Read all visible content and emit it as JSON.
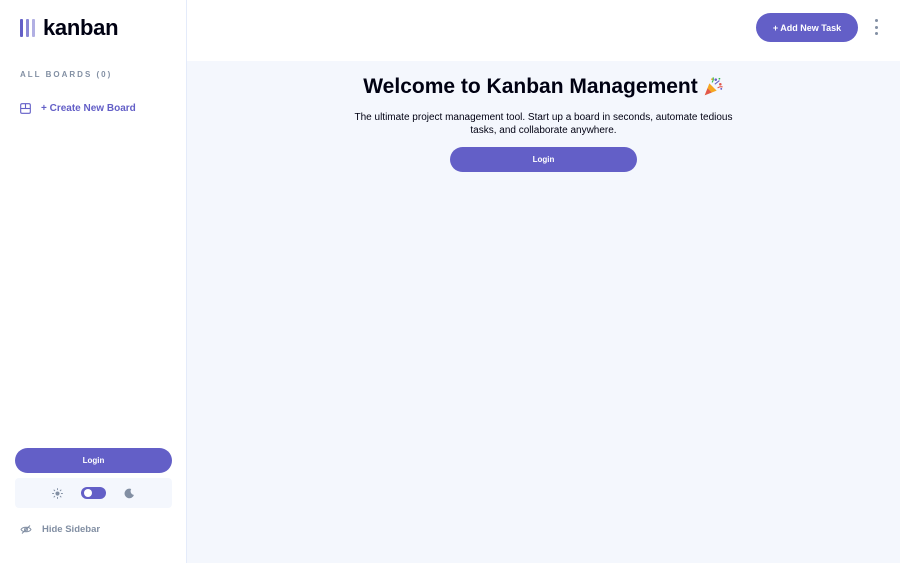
{
  "app": {
    "name": "kanban"
  },
  "sidebar": {
    "all_boards_label": "ALL BOARDS (0)",
    "create_board_label": "+ Create New Board",
    "login_label": "Login",
    "hide_sidebar_label": "Hide Sidebar",
    "theme": {
      "mode": "dark",
      "toggle_on": true
    }
  },
  "header": {
    "add_task_label": "+ Add New Task",
    "menu_icon": "kebab-menu-icon"
  },
  "main": {
    "welcome_title": "Welcome to Kanban Management",
    "welcome_icon": "party-popper-icon",
    "description": "The ultimate project management tool. Start up a board in seconds, automate tedious tasks, and collaborate anywhere.",
    "login_label": "Login"
  },
  "colors": {
    "accent": "#635fc7",
    "background": "#f4f7fd",
    "surface": "#ffffff",
    "muted_text": "#828fa3",
    "text": "#000112"
  }
}
